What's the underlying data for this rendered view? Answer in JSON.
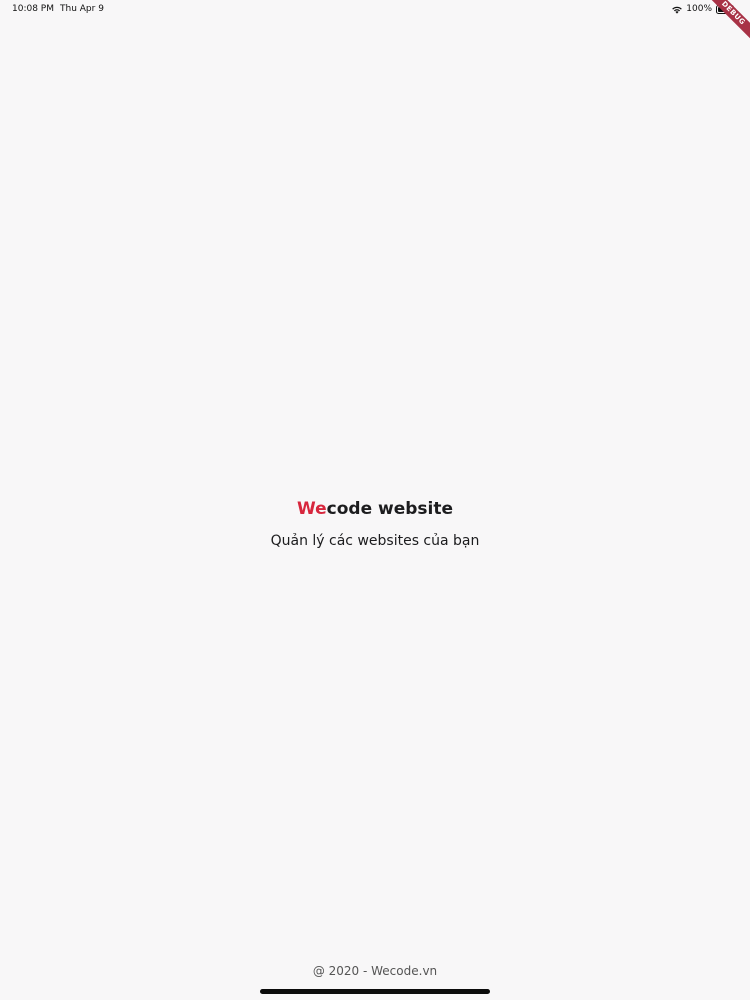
{
  "status_bar": {
    "time": "10:08 PM",
    "date": "Thu Apr 9",
    "battery_percent": "100%",
    "battery_level": 1.0,
    "icons": [
      "wifi-icon",
      "battery-icon"
    ]
  },
  "debug_banner": {
    "label": "DEBUG",
    "color": "#a83246"
  },
  "main": {
    "title_accent": "We",
    "title_rest": "code website",
    "subtitle": "Quản lý các websites của bạn",
    "accent_color": "#d7263d"
  },
  "footer": {
    "text": "@ 2020 - Wecode.vn"
  }
}
